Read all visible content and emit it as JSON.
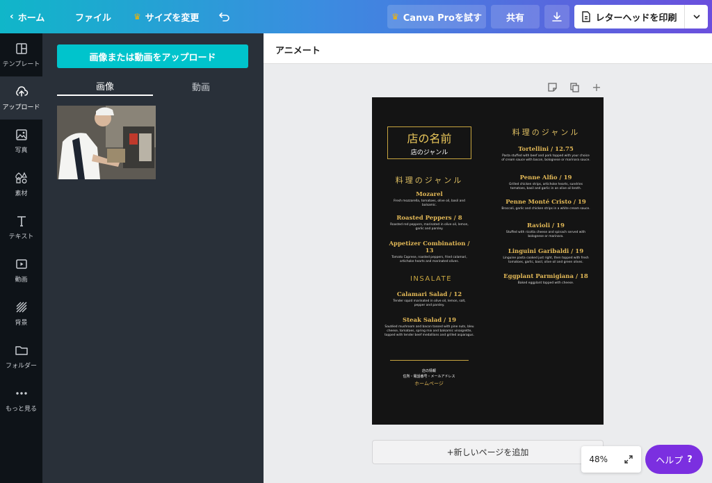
{
  "topbar": {
    "home": "ホーム",
    "file": "ファイル",
    "resize": "サイズを変更",
    "pro": "Canva Proを試す",
    "share": "共有",
    "print": "レターヘッドを印刷"
  },
  "rail": {
    "items": [
      {
        "label": "テンプレート",
        "icon": "template-icon"
      },
      {
        "label": "アップロード",
        "icon": "upload-icon"
      },
      {
        "label": "写真",
        "icon": "photo-icon"
      },
      {
        "label": "素材",
        "icon": "elements-icon"
      },
      {
        "label": "テキスト",
        "icon": "text-icon"
      },
      {
        "label": "動画",
        "icon": "video-icon"
      },
      {
        "label": "背景",
        "icon": "background-icon"
      },
      {
        "label": "フォルダー",
        "icon": "folder-icon"
      },
      {
        "label": "もっと見る",
        "icon": "more-icon"
      }
    ]
  },
  "panel": {
    "upload_button": "画像または動画をアップロード",
    "tabs": [
      "画像",
      "動画"
    ]
  },
  "toolbar": {
    "font_name": "アニメート"
  },
  "menu": {
    "name": "店の名前",
    "genre": "店のジャンル",
    "left_heading": "料理のジャンル",
    "right_heading": "料理のジャンル",
    "left_items": [
      {
        "title": "Mozarel",
        "desc": "Fresh mozzarella, tomatoes, olive oil, basil and balsamic."
      },
      {
        "title": "Roasted Peppers / 8",
        "desc": "Roasted red peppers, marinated in olive oil, lemon, garlic and parsley."
      },
      {
        "title": "Appetizer Combination / 13",
        "desc": "Tomato Caprese, roasted peppers, fried calamari, artichoke hearts and marinated olives."
      }
    ],
    "insalate": "INSALATE",
    "salad_items": [
      {
        "title": "Calamari Salad / 12",
        "desc": "Tender squid marinated in olive oil, lemon, salt, pepper and parsley."
      },
      {
        "title": "Steak Salad / 19",
        "desc": "Sautéed mushroom and bacon tossed with pine nuts, bleu cheese, tomatoes, spring mix and balsamic vinaigrette, topped with tender beef medallions and grilled asparagus."
      }
    ],
    "right_items": [
      {
        "title": "Tortellini / 12.75",
        "desc": "Pasta stuffed with beef and pork topped with your choice of cream sauce with bacon, bolognese or marinara sauce."
      },
      {
        "title": "Penne Alfio / 19",
        "desc": "Grilled chicken strips, artichoke hearts, sundries tomatoes, basil and garlic in an olive oil broth."
      },
      {
        "title": "Penne Monté Cristo / 19",
        "desc": "Broccoli, garlic and chicken strips in a white cream sauce."
      },
      {
        "title": "Ravioli / 19",
        "desc": "Stuffed with ricotta cheese and spinach served with bolognese or marinara."
      },
      {
        "title": "Linguini Garibaldi / 19",
        "desc": "Linguine pasta cooked just right, then topped with fresh tomatoes, garlic, basil, olive oil and green olives."
      },
      {
        "title": "Eggplant Parmigiana / 18",
        "desc": "Baked eggplant topped with cheese."
      }
    ],
    "footer_title": "店の情報",
    "footer_info": "住所・電話番号・メールアドレス",
    "footer_link": "ホームページ"
  },
  "bottom": {
    "add_page": "+新しいページを追加",
    "zoom": "48%",
    "help": "ヘルプ",
    "help_icon": "?"
  },
  "colors": {
    "accent": "#00c4cc",
    "gold": "#e3b957",
    "help": "#7b2fe0"
  }
}
